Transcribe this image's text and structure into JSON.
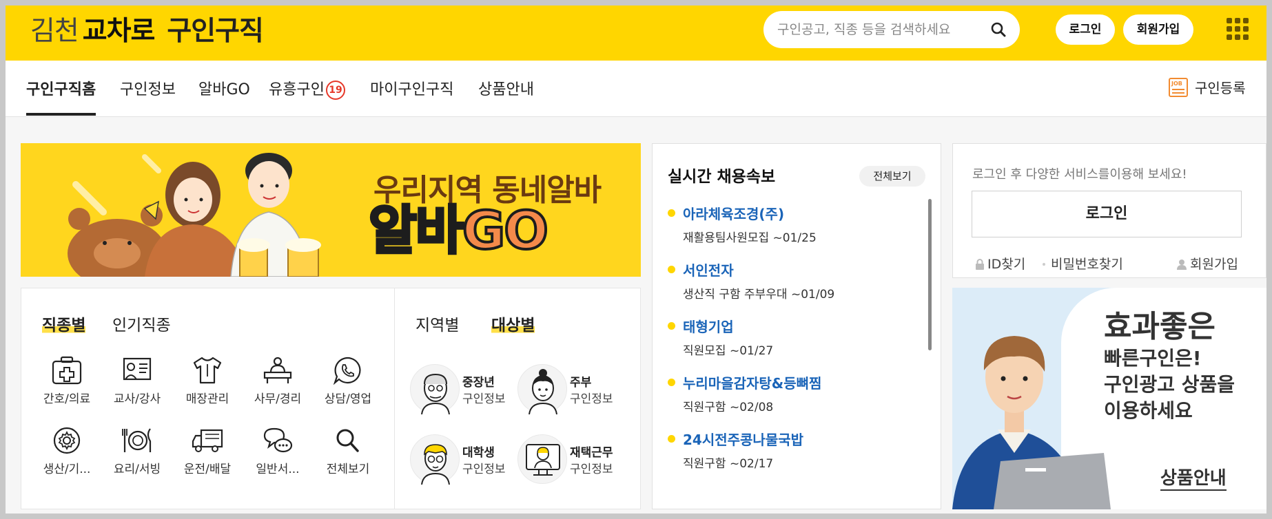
{
  "header": {
    "logo": {
      "part1": "김천",
      "part2": "교차로",
      "part3": "구인구직"
    },
    "search_placeholder": "구인공고, 직종 등을 검색하세요",
    "login_label": "로그인",
    "join_label": "회원가입"
  },
  "nav": {
    "items": [
      {
        "label": "구인구직홈"
      },
      {
        "label": "구인정보"
      },
      {
        "label": "알바GO"
      },
      {
        "label": "유흥구인",
        "badge": "19"
      },
      {
        "label": "마이구인구직"
      },
      {
        "label": "상품안내"
      }
    ],
    "register_label": "구인등록",
    "register_icon_text": "JOB"
  },
  "banner": {
    "subtitle": "우리지역 동네알바",
    "title_a": "알바",
    "title_b": "GO"
  },
  "categories": {
    "tabs": [
      "직종별",
      "인기직종"
    ],
    "items": [
      {
        "label": "간호/의료",
        "icon": "medical-kit-icon"
      },
      {
        "label": "교사/강사",
        "icon": "teacher-board-icon"
      },
      {
        "label": "매장관리",
        "icon": "shirt-icon"
      },
      {
        "label": "사무/경리",
        "icon": "office-desk-icon"
      },
      {
        "label": "상담/영업",
        "icon": "phone-chat-icon"
      },
      {
        "label": "생산/기...",
        "icon": "gear-icon"
      },
      {
        "label": "요리/서빙",
        "icon": "plate-fork-icon"
      },
      {
        "label": "운전/배달",
        "icon": "truck-icon"
      },
      {
        "label": "일반서...",
        "icon": "speech-bubble-icon"
      },
      {
        "label": "전체보기",
        "icon": "search-icon"
      }
    ]
  },
  "targets": {
    "tabs": [
      "지역별",
      "대상별"
    ],
    "items": [
      {
        "title": "중장년",
        "sub": "구인정보"
      },
      {
        "title": "주부",
        "sub": "구인정보"
      },
      {
        "title": "대학생",
        "sub": "구인정보"
      },
      {
        "title": "재택근무",
        "sub": "구인정보"
      }
    ]
  },
  "realtime": {
    "title": "실시간 채용속보",
    "view_all": "전체보기",
    "items": [
      {
        "company": "아라체육조경(주)",
        "job": "재활용팀사원모집 ~01/25"
      },
      {
        "company": "서인전자",
        "job": "생산직 구함 주부우대 ~01/09"
      },
      {
        "company": "태형기업",
        "job": "직원모집 ~01/27"
      },
      {
        "company": "누리마을감자탕&등뼈찜",
        "job": "직원구함 ~02/08"
      },
      {
        "company": "24시전주콩나물국밥",
        "job": "직원구함 ~02/17"
      }
    ]
  },
  "login_box": {
    "message": "로그인 후 다양한 서비스를이용해 보세요!",
    "login_label": "로그인",
    "find_id": "ID찾기",
    "find_pw": "비밀번호찾기",
    "join": "회원가입"
  },
  "ad": {
    "line1": "효과좋은",
    "line2": "빠른구인은!",
    "line3": "구인광고 상품을",
    "line4": "이용하세요",
    "more": "상품안내"
  },
  "colors": {
    "brand_yellow": "#ffd600",
    "link_blue": "#1a64b8",
    "badge_red": "#e6392a"
  }
}
